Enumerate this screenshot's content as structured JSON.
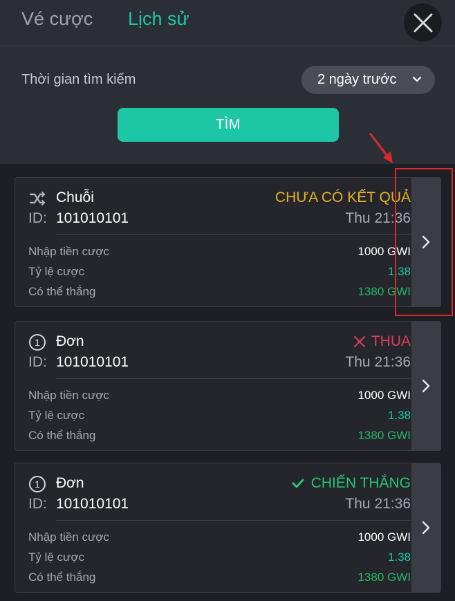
{
  "tabs": [
    {
      "label": "Vé cược"
    },
    {
      "label": "Lịch sử"
    }
  ],
  "filter": {
    "label": "Thời gian tìm kiếm",
    "selected": "2 ngày trước",
    "search_button": "TÌM"
  },
  "bets": [
    {
      "type": "Chuỗi",
      "type_icon": "parlay-icon",
      "status": "CHƯA CÓ KẾT QUẢ",
      "status_icon": "",
      "id_label": "ID:",
      "id": "101010101",
      "time": "Thu 21:36",
      "stake_label": "Nhập tiền cược",
      "stake": "1000 GWI",
      "odds_label": "Tỷ lệ cược",
      "odds": "1.38",
      "win_label": "Có thể thắng",
      "win": "1380 GWI"
    },
    {
      "type": "Đơn",
      "type_icon": "single-bet-icon",
      "status": "THUA",
      "status_icon": "x-icon",
      "id_label": "ID:",
      "id": "101010101",
      "time": "Thu 21:36",
      "stake_label": "Nhập tiền cược",
      "stake": "1000 GWI",
      "odds_label": "Tỷ lệ cược",
      "odds": "1.38",
      "win_label": "Có thể thắng",
      "win": "1380 GWI"
    },
    {
      "type": "Đơn",
      "type_icon": "single-bet-icon",
      "status": "CHIẾN THẮNG",
      "status_icon": "check-icon",
      "id_label": "ID:",
      "id": "101010101",
      "time": "Thu 21:36",
      "stake_label": "Nhập tiền cược",
      "stake": "1000 GWI",
      "odds_label": "Tỷ lệ cược",
      "odds": "1.38",
      "win_label": "Có thể thắng",
      "win": "1380 GWI"
    }
  ],
  "colors": {
    "accent": "#1dc7a5",
    "pending": "#e6b224",
    "lose": "#e23c5b",
    "win": "#29c373",
    "annotation": "#d92b2b"
  }
}
